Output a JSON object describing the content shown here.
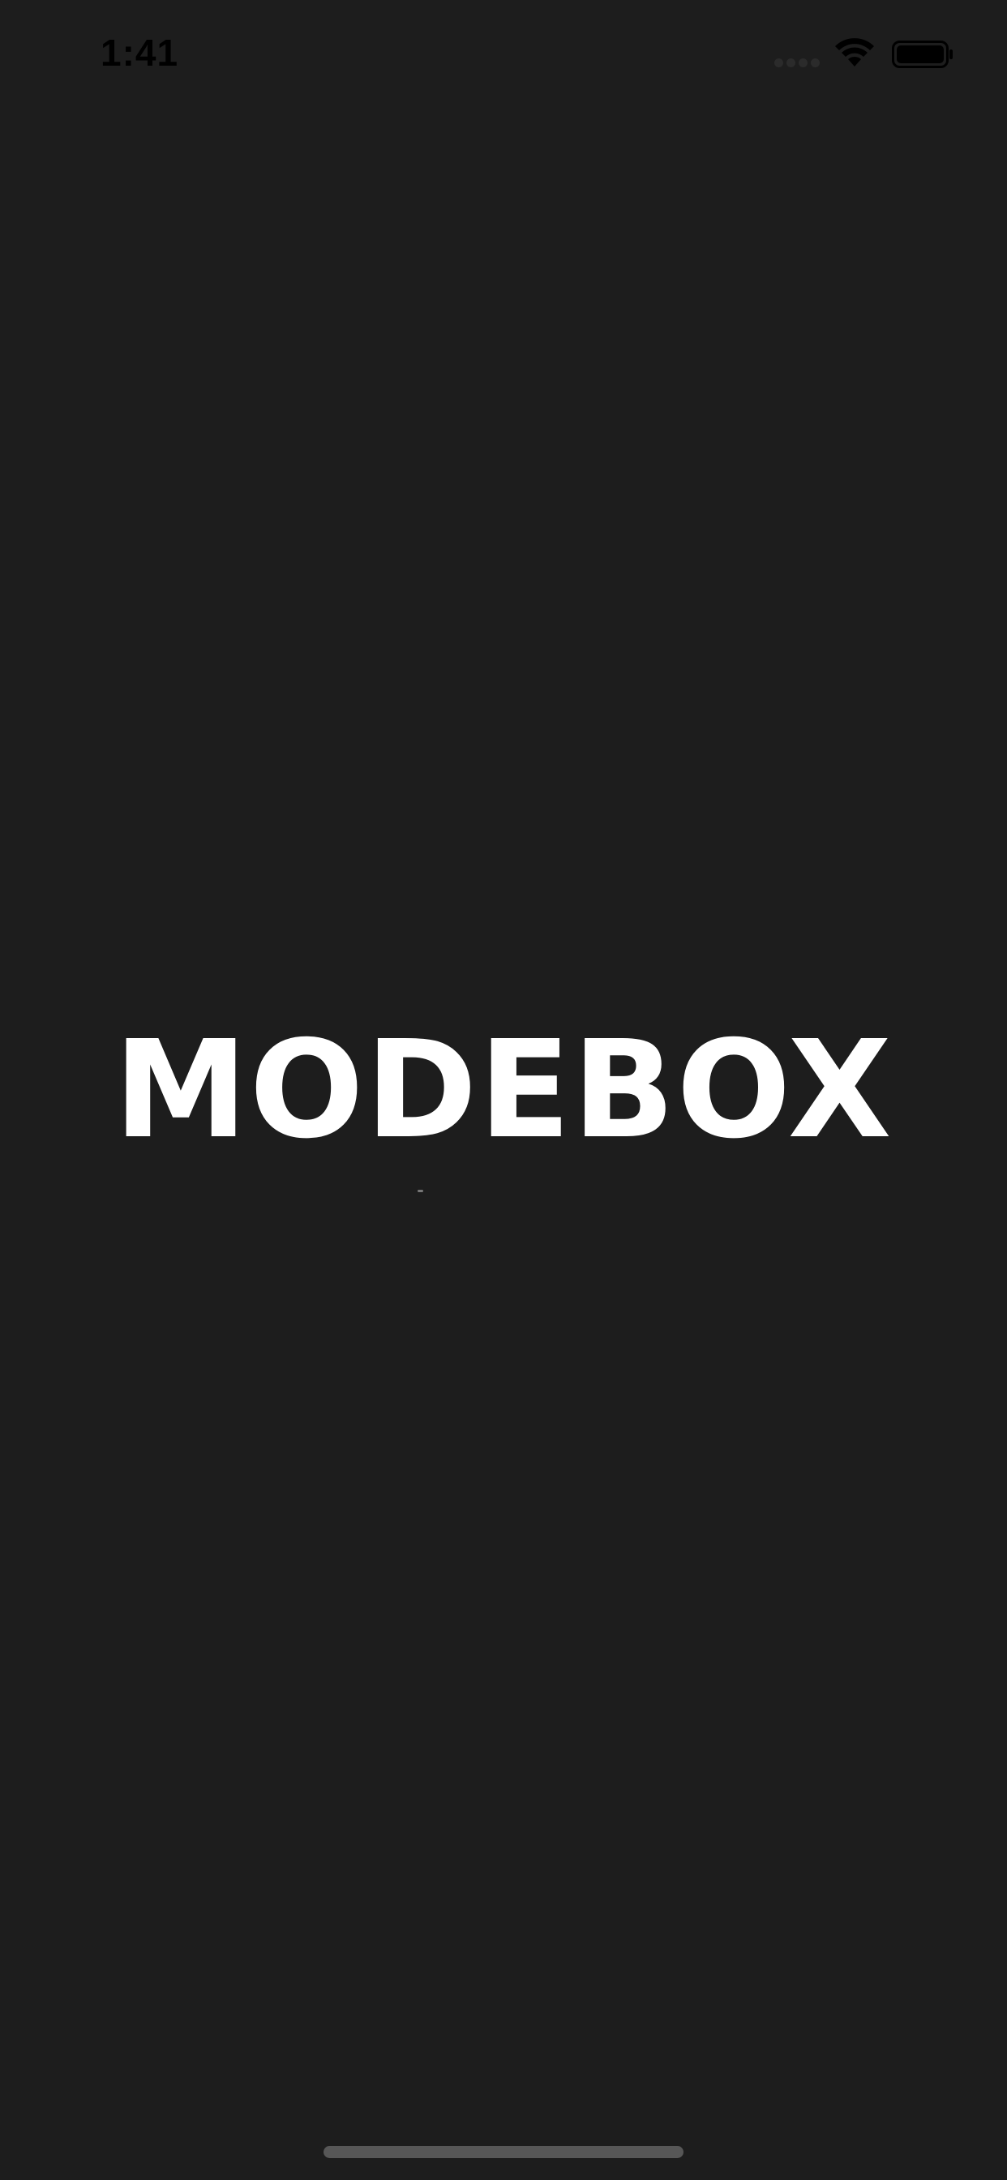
{
  "status_bar": {
    "time": "1:41",
    "icons": [
      "signal-icon",
      "wifi-icon",
      "battery-icon"
    ]
  },
  "splash": {
    "logo_text": "MODEBOX"
  },
  "colors": {
    "background": "#1d1d1d",
    "logo": "#ffffff",
    "status_text": "#000000",
    "home_indicator": "#575757"
  }
}
